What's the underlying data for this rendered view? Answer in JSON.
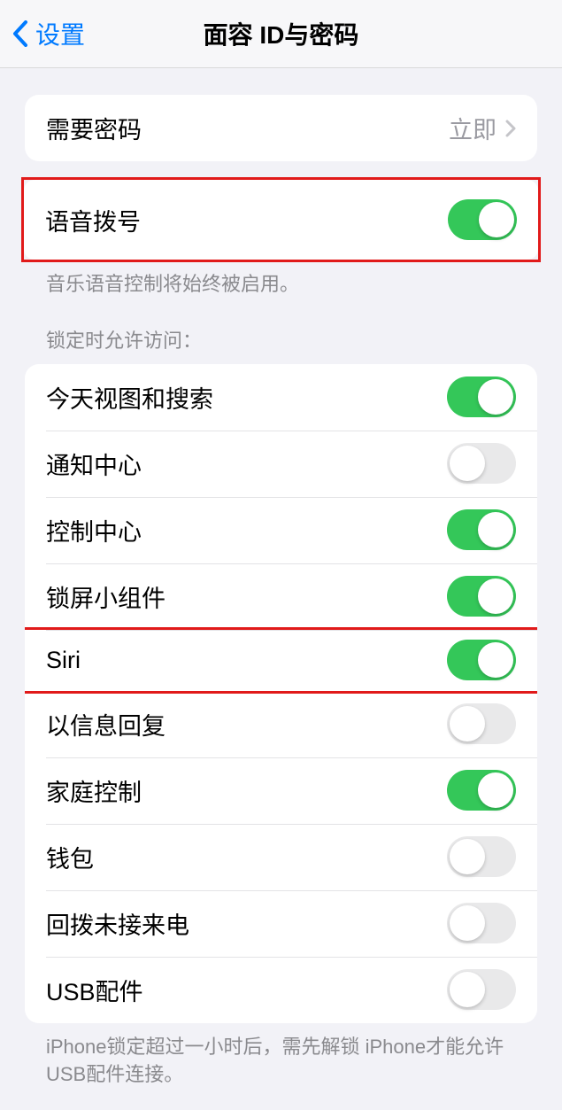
{
  "nav": {
    "back": "设置",
    "title": "面容 ID与密码"
  },
  "require_passcode": {
    "label": "需要密码",
    "value": "立即"
  },
  "voice_dial": {
    "label": "语音拨号",
    "on": true
  },
  "voice_dial_note": "音乐语音控制将始终被启用。",
  "lock_access_header": "锁定时允许访问：",
  "lock_items": [
    {
      "label": "今天视图和搜索",
      "on": true
    },
    {
      "label": "通知中心",
      "on": false
    },
    {
      "label": "控制中心",
      "on": true
    },
    {
      "label": "锁屏小组件",
      "on": true
    },
    {
      "label": "Siri",
      "on": true
    },
    {
      "label": "以信息回复",
      "on": false
    },
    {
      "label": "家庭控制",
      "on": true
    },
    {
      "label": "钱包",
      "on": false
    },
    {
      "label": "回拨未接来电",
      "on": false
    },
    {
      "label": "USB配件",
      "on": false
    }
  ],
  "usb_note": "iPhone锁定超过一小时后，需先解锁 iPhone才能允许USB配件连接。",
  "highlight_indices": [
    4
  ]
}
